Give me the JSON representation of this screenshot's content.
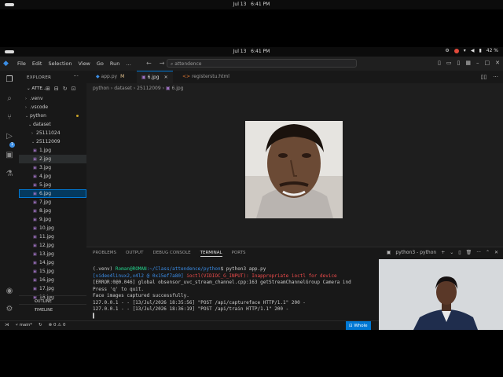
{
  "system_bar": {
    "date": "Jul 13",
    "time": "6:41 PM",
    "battery": "42 %"
  },
  "menu": [
    "File",
    "Edit",
    "Selection",
    "View",
    "Go",
    "Run"
  ],
  "search": {
    "placeholder": "attendence"
  },
  "explorer": {
    "header": "EXPLORER",
    "project": "ATTE...",
    "items": [
      ".venv",
      ".vscode",
      "python",
      "dataset",
      "25111024",
      "25112009"
    ],
    "files": [
      "1.jpg",
      "2.jpg",
      "3.jpg",
      "4.jpg",
      "5.jpg",
      "6.jpg",
      "7.jpg",
      "8.jpg",
      "9.jpg",
      "10.jpg",
      "11.jpg",
      "12.jpg",
      "13.jpg",
      "14.jpg",
      "15.jpg",
      "16.jpg",
      "17.jpg",
      "18.jpg"
    ],
    "outline": "OUTLINE",
    "timeline": "TIMELINE"
  },
  "tabs": [
    {
      "label": "app.py",
      "modified": "M"
    },
    {
      "label": "6.jpg"
    },
    {
      "label": "registerstu.html"
    }
  ],
  "breadcrumb": [
    "python",
    "dataset",
    "25112009",
    "6.jpg"
  ],
  "panel": {
    "tabs": [
      "PROBLEMS",
      "OUTPUT",
      "DEBUG CONSOLE",
      "TERMINAL",
      "PORTS"
    ],
    "shell_label": "python3 - python"
  },
  "terminal": {
    "venv": "(.venv) ",
    "user_host": "Roman@ROMAN",
    "path": ":~/Class/attendence/python",
    "prompt_tail": "$ python3 app.py",
    "err1_a": "[video4linux2,v4l2 @ 0x15ef7a80] ",
    "err1_b": "ioctl(VIDIOC_G_INPUT): Inappropriate ioctl for device",
    "line2": "[ERROR:0@0.046] global obsensor_uvc_stream_channel.cpp:163 getStreamChannelGroup Camera ind",
    "line3": "Press 'q' to quit.",
    "line4": "Face images captured successfully.",
    "line5": "127.0.0.1 - - [13/Jul/2026 18:35:56] \"POST /api/captureface HTTP/1.1\" 200 -",
    "line6": "127.0.0.1 - - [13/Jul/2026 18:36:19] \"POST /api/train HTTP/1.1\" 200 -",
    "cursor": "▌"
  },
  "status": {
    "branch": "main*",
    "problems": "⊗ 0 ⚠ 0",
    "whole": "Whole"
  }
}
